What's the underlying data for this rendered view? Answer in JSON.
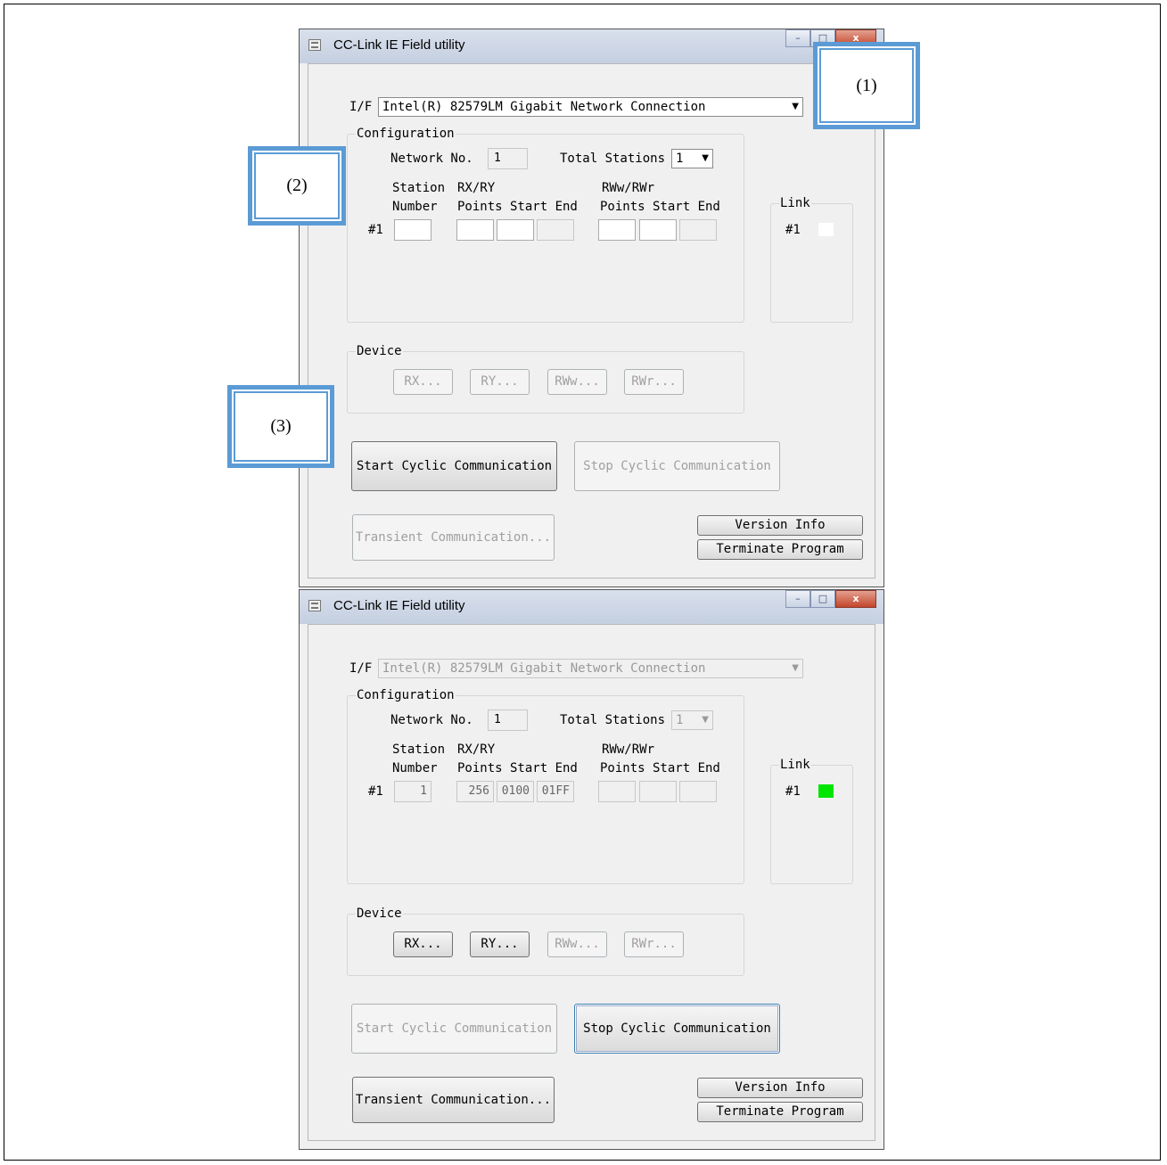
{
  "windows": [
    {
      "title": "CC-Link IE Field utility",
      "controls": [
        "–",
        "□",
        "x"
      ],
      "if_label": "I/F",
      "if_value": "Intel(R) 82579LM Gigabit Network Connection",
      "config_title": "Configuration",
      "network_no_label": "Network No.",
      "network_no": "1",
      "total_stations_label": "Total Stations",
      "total_stations": "1",
      "station_label_1": "Station",
      "station_label_2": "Number",
      "rxry_label": "RX/RY",
      "rxry_cols": "Points Start End",
      "rwwrwr_label": "RWw/RWr",
      "rwwrwr_cols": "Points Start End",
      "row_label": "#1",
      "station_number": "",
      "rxry_points": "",
      "rxry_start": "",
      "rxry_end": "",
      "rww_points": "",
      "rww_start": "",
      "rww_end": "",
      "link_title": "Link",
      "link_row": "#1",
      "link_color": "#ffffff",
      "device_title": "Device",
      "device_buttons": [
        "RX...",
        "RY...",
        "RWw...",
        "RWr..."
      ],
      "start_btn": "Start Cyclic Communication",
      "stop_btn": "Stop Cyclic Communication",
      "transient_btn": "Transient Communication...",
      "version_btn": "Version Info",
      "terminate_btn": "Terminate Program"
    },
    {
      "title": "CC-Link IE Field utility",
      "controls": [
        "–",
        "□",
        "x"
      ],
      "if_label": "I/F",
      "if_value": "Intel(R) 82579LM Gigabit Network Connection",
      "config_title": "Configuration",
      "network_no_label": "Network No.",
      "network_no": "1",
      "total_stations_label": "Total Stations",
      "total_stations": "1",
      "station_label_1": "Station",
      "station_label_2": "Number",
      "rxry_label": "RX/RY",
      "rxry_cols": "Points Start End",
      "rwwrwr_label": "RWw/RWr",
      "rwwrwr_cols": "Points Start End",
      "row_label": "#1",
      "station_number": "1",
      "rxry_points": "256",
      "rxry_start": "0100",
      "rxry_end": "01FF",
      "rww_points": "",
      "rww_start": "",
      "rww_end": "",
      "link_title": "Link",
      "link_row": "#1",
      "link_color": "#00e600",
      "device_title": "Device",
      "device_buttons": [
        "RX...",
        "RY...",
        "RWw...",
        "RWr..."
      ],
      "start_btn": "Start Cyclic Communication",
      "stop_btn": "Stop Cyclic Communication",
      "transient_btn": "Transient Communication...",
      "version_btn": "Version Info",
      "terminate_btn": "Terminate Program"
    }
  ],
  "callouts": [
    "(1)",
    "(2)",
    "(3)"
  ],
  "colors": {
    "callout_border": "#5b9bd5",
    "link_active": "#00e600"
  }
}
